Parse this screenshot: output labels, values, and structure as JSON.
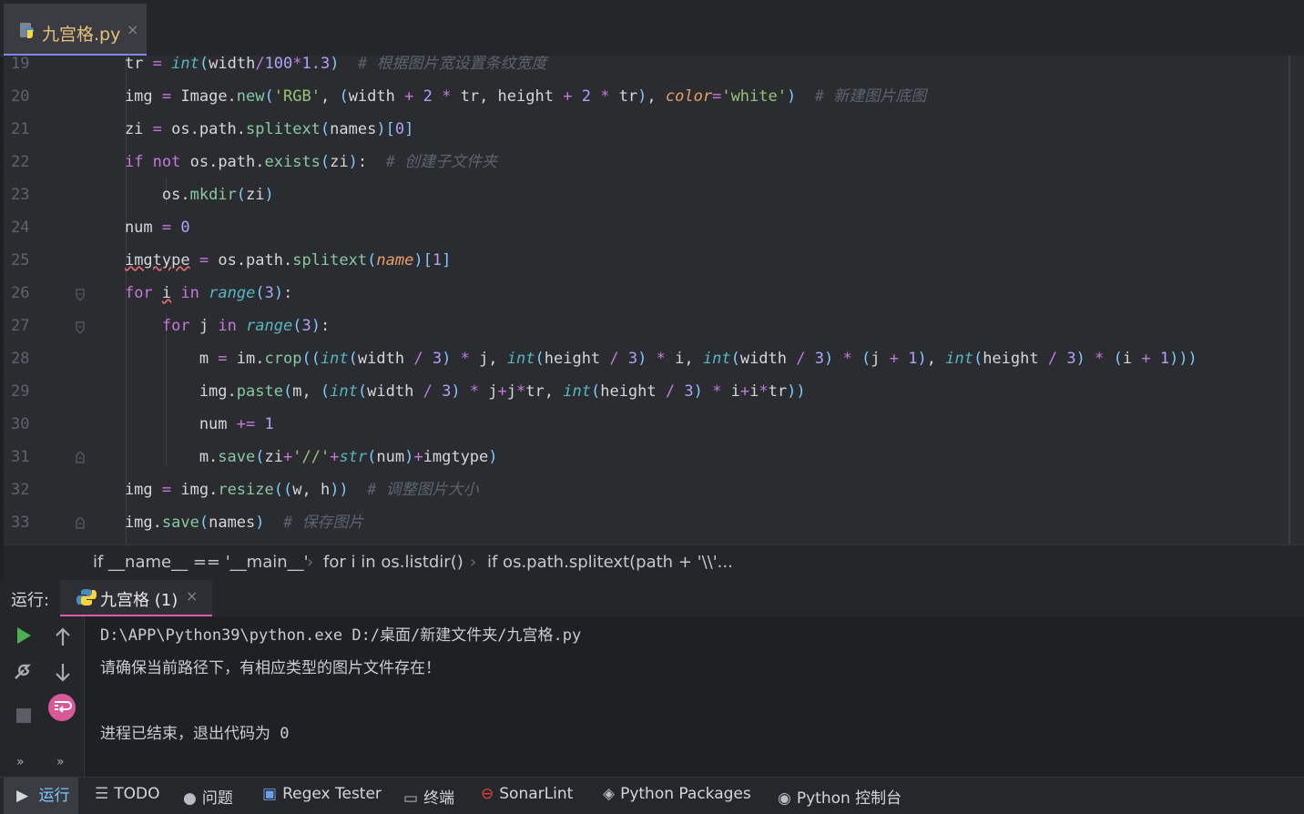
{
  "tab": {
    "file_name": "九宫格.py",
    "close": "×"
  },
  "editor": {
    "line_numbers": [
      "19",
      "20",
      "21",
      "22",
      "23",
      "24",
      "25",
      "26",
      "27",
      "28",
      "29",
      "30",
      "31",
      "32",
      "33"
    ]
  },
  "breadcrumb": {
    "items": [
      "if __name__ == '__main__'",
      "for i in os.listdir()",
      "if os.path.splitext(path + '\\\\'..."
    ],
    "separator": "›"
  },
  "run": {
    "label": "运行:",
    "tab_name": "九宫格 (1)",
    "close": "×",
    "output": [
      "D:\\APP\\Python39\\python.exe D:/桌面/新建文件夹/九宫格.py",
      "请确保当前路径下，有相应类型的图片文件存在！",
      "进程已结束，退出代码为 0"
    ]
  },
  "toolbar": {
    "run": "运行",
    "todo": "TODO",
    "problems": "问题",
    "regex": "Regex Tester",
    "terminal": "终端",
    "sonar": "SonarLint",
    "packages": "Python Packages",
    "console": "Python 控制台"
  },
  "colors": {
    "accent_tab": "#7c8aff",
    "run_tab_underline": "#e05aa7",
    "background": "#2b2c30"
  }
}
